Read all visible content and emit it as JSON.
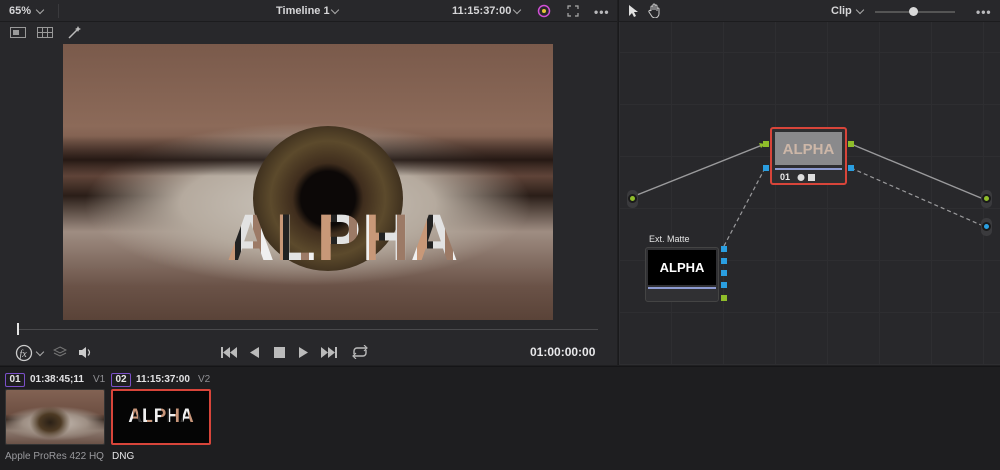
{
  "viewer": {
    "zoom": "65%",
    "timeline_name": "Timeline 1",
    "source_timecode": "11:15:37:00",
    "more": "•••",
    "image_text": "ALPHA",
    "playback_timecode": "01:00:00:00",
    "playhead_fraction": 0.0
  },
  "node_editor": {
    "mode": "Clip",
    "more": "•••",
    "zoom_slider_fraction": 0.42,
    "node_main": {
      "label": "01",
      "thumb_text": "ALPHA"
    },
    "node_matte": {
      "title": "Ext. Matte",
      "thumb_text": "ALPHA"
    }
  },
  "clips": [
    {
      "number": "01",
      "timecode": "01:38:45;11",
      "track": "V1",
      "name": "Apple ProRes 422 HQ",
      "selected": false
    },
    {
      "number": "02",
      "timecode": "11:15:37:00",
      "track": "V2",
      "name": "DNG",
      "thumb_text": "ALPHA",
      "selected": true
    }
  ],
  "colors": {
    "accent_red": "#d8453a",
    "port_green": "#8fbd2a",
    "port_blue": "#2a9ee0",
    "clip_number_border": "#7a50c8"
  }
}
